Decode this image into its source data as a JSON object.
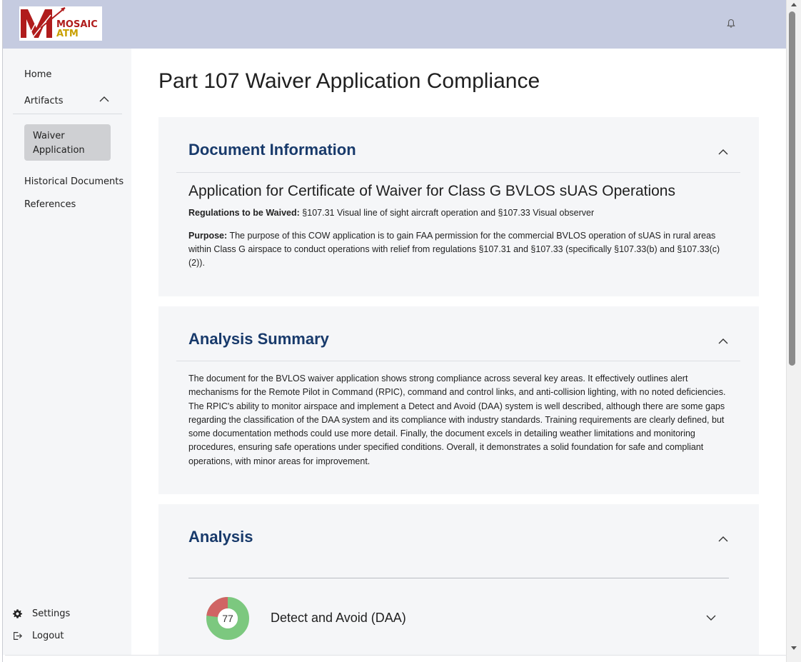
{
  "header": {
    "logo": {
      "line1": "MOSAIC",
      "line2": "ATM",
      "alt": "MOSAIC ATM"
    },
    "notifications_icon": "bell-icon"
  },
  "sidebar": {
    "home": "Home",
    "artifacts": "Artifacts",
    "artifacts_children": [
      "Waiver Application"
    ],
    "historical_documents": "Historical Documents",
    "references": "References",
    "settings": "Settings",
    "logout": "Logout"
  },
  "page": {
    "title": "Part 107 Waiver Application Compliance"
  },
  "document_information": {
    "section_title": "Document Information",
    "heading": "Application for Certificate of Waiver for Class G BVLOS sUAS Operations",
    "regulations_label": "Regulations to be Waived:",
    "regulations_value": "§107.31 Visual line of sight aircraft operation and §107.33 Visual observer",
    "purpose_label": "Purpose:",
    "purpose_value": "The purpose of this COW application is to gain FAA permission for the commercial BVLOS operation of sUAS in rural areas within Class G airspace to conduct operations with relief from regulations §107.31 and §107.33 (specifically §107.33(b) and §107.33(c)(2))."
  },
  "analysis_summary": {
    "section_title": "Analysis Summary",
    "text": "The document for the BVLOS waiver application shows strong compliance across several key areas. It effectively outlines alert mechanisms for the Remote Pilot in Command (RPIC), command and control links, and anti-collision lighting, with no noted deficiencies. The RPIC's ability to monitor airspace and implement a Detect and Avoid (DAA) system is well described, although there are some gaps regarding the classification of the DAA system and its compliance with industry standards. Training requirements are clearly defined, but some documentation methods could use more detail. Finally, the document excels in detailing weather limitations and monitoring procedures, ensuring safe operations under specified conditions. Overall, it demonstrates a solid foundation for safe and compliant operations, with minor areas for improvement."
  },
  "analysis": {
    "section_title": "Analysis",
    "items": [
      {
        "title": "Detect and Avoid (DAA)",
        "score": "77",
        "score_fraction": 0.77
      }
    ]
  },
  "colors": {
    "header_bg": "#c5cbe0",
    "section_title": "#183a6b",
    "score_good": "#7cc87f",
    "score_bad": "#d06464",
    "selected_nav_bg": "#cfd0d3"
  }
}
